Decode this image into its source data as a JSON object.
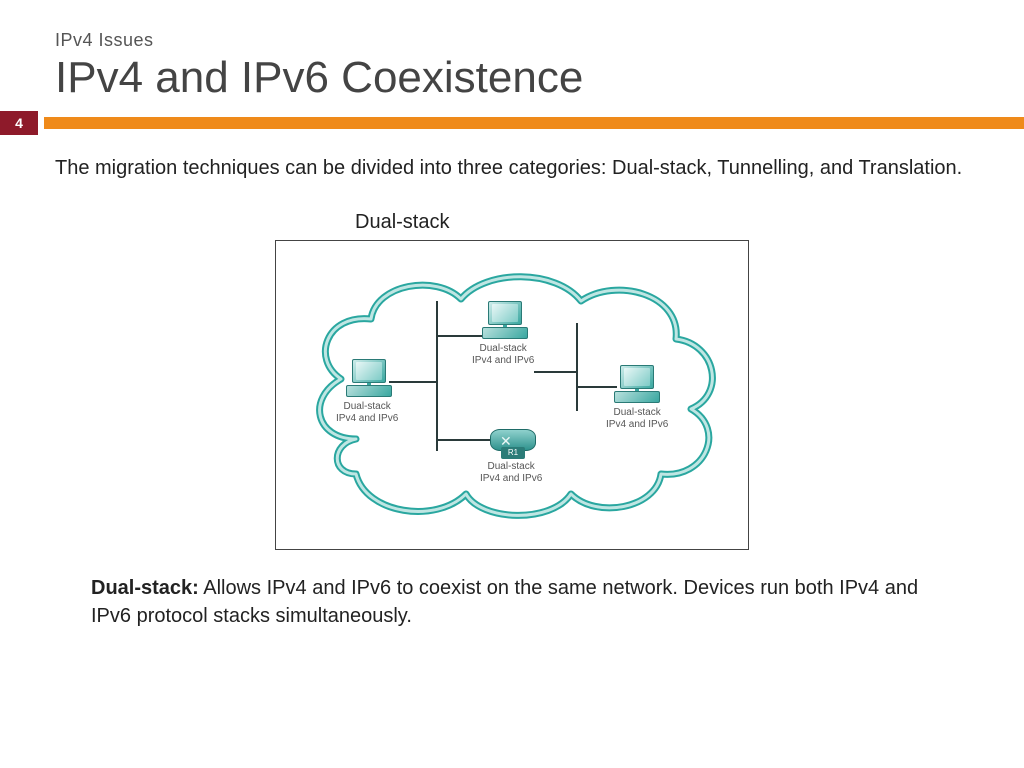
{
  "header": {
    "subtitle": "IPv4 Issues",
    "title": "IPv4 and IPv6 Coexistence",
    "pageNumber": "4"
  },
  "content": {
    "intro": "The migration techniques can be divided into three categories: Dual-stack, Tunnelling, and Translation.",
    "diagramLabel": "Dual-stack",
    "devices": {
      "pcLeft": {
        "line1": "Dual-stack",
        "line2": "IPv4 and IPv6"
      },
      "pcTop": {
        "line1": "Dual-stack",
        "line2": "IPv4 and IPv6"
      },
      "pcRight": {
        "line1": "Dual-stack",
        "line2": "IPv4 and IPv6"
      },
      "router": {
        "name": "R1",
        "line1": "Dual-stack",
        "line2": "IPv4 and IPv6"
      }
    },
    "footer": {
      "bold": "Dual-stack:",
      "text": " Allows IPv4 and IPv6 to coexist on the same network. Devices run both IPv4 and IPv6 protocol stacks simultaneously."
    }
  },
  "colors": {
    "accent": "#ef8a1a",
    "badge": "#8e1a2a",
    "teal": "#3aa7a0"
  }
}
